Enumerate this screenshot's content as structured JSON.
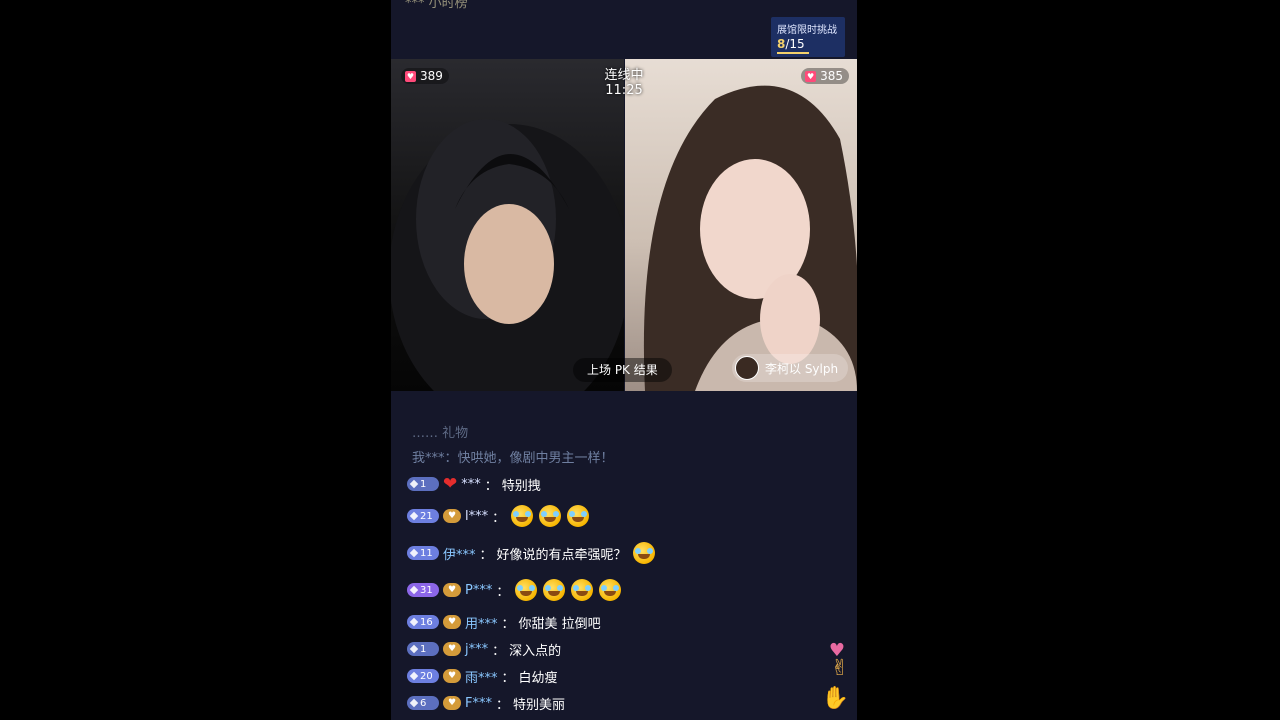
{
  "top_text": "*** 小时榜",
  "challenge": {
    "title": "展馆限时挑战",
    "progress": "8",
    "total": "/15"
  },
  "pk": {
    "left_score": "389",
    "right_score": "385",
    "timer": "连线中 11:25",
    "result_button": "上场 PK 结果",
    "anchor_name": "李柯以 Sylph"
  },
  "chat": {
    "faded": "…… 礼物",
    "plain_message": "我***：快哄她，像剧中男主一样！",
    "messages": [
      {
        "level": "1",
        "user": "***",
        "text": "特别拽",
        "badge": "heart",
        "emojis": 0
      },
      {
        "level": "21",
        "user": "l***",
        "text": "",
        "badge": "fan",
        "emojis": 3
      },
      {
        "level": "11",
        "user": "伊***",
        "text": "好像说的有点牵强呢？",
        "badge": "none",
        "emojis": 1
      },
      {
        "level": "31",
        "user": "P***",
        "text": "",
        "badge": "fan",
        "emojis": 4
      },
      {
        "level": "16",
        "user": "用***",
        "text": "你甜美 拉倒吧",
        "badge": "fan",
        "emojis": 0
      },
      {
        "level": "1",
        "user": "j***",
        "text": "深入点的",
        "badge": "fan",
        "emojis": 0
      },
      {
        "level": "20",
        "user": "雨***",
        "text": "白幼瘦",
        "badge": "fan",
        "emojis": 0
      },
      {
        "level": "6",
        "user": "F***",
        "text": "特别美丽",
        "badge": "fan",
        "emojis": 0
      }
    ]
  },
  "colors": {
    "level_low": "#5c6fbf",
    "level_mid": "#6d7fe0",
    "level_high": "#8c66e8",
    "accent": "#f3d16b"
  },
  "icons": [
    "heart-icon",
    "gem-icon",
    "fan-badge-icon",
    "laugh-emoji-icon",
    "hand-icon"
  ]
}
